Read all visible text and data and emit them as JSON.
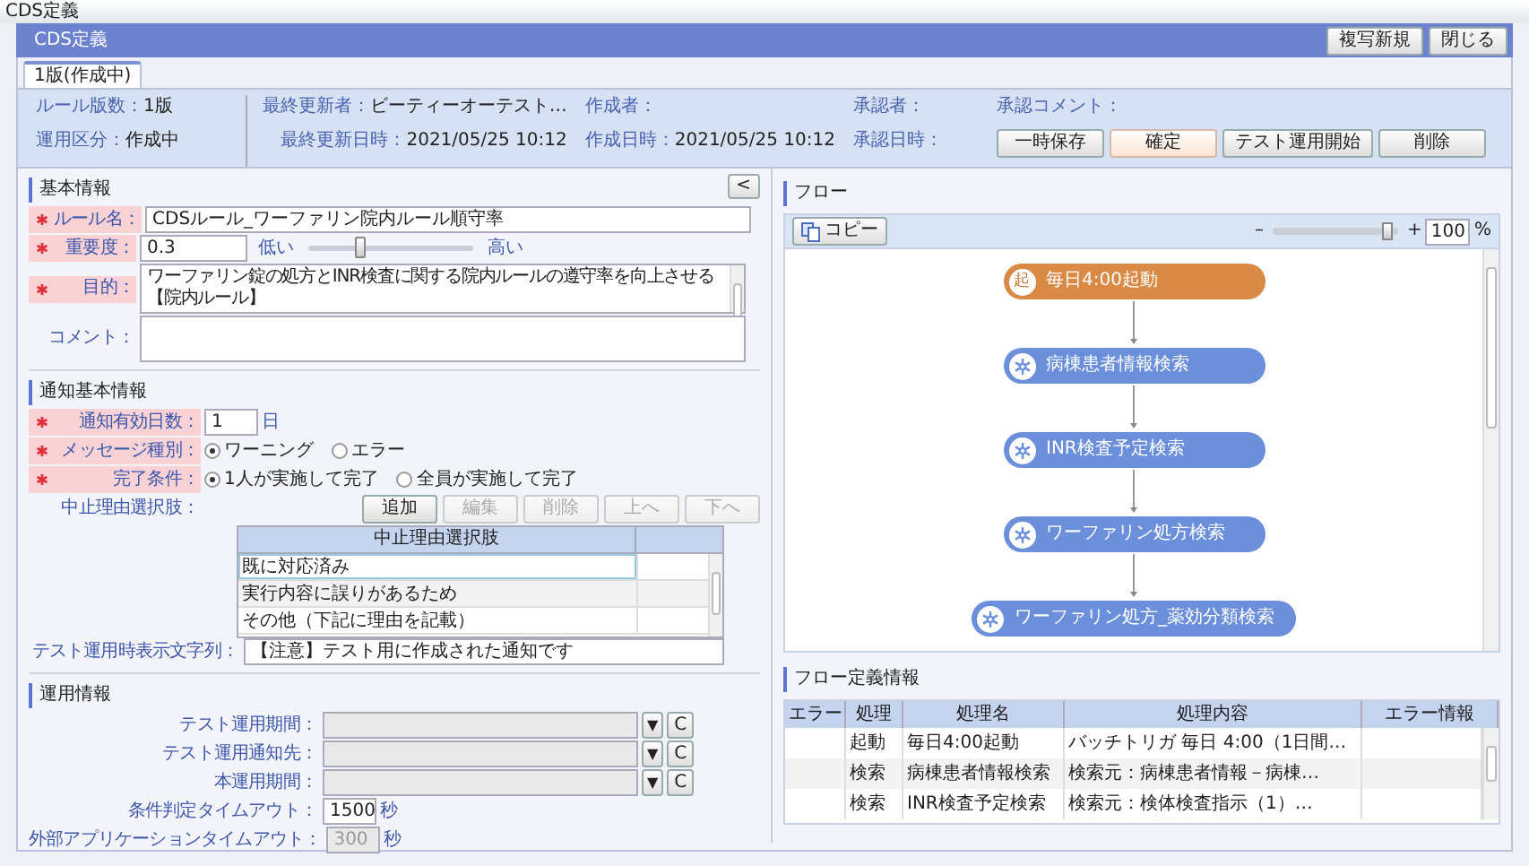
{
  "window": {
    "title": "CDS定義"
  },
  "header": {
    "title": "CDS定義",
    "buttons": [
      {
        "label": "複写新規"
      },
      {
        "label": "閉じる"
      }
    ]
  },
  "tabs": [
    {
      "label": "1版(作成中)",
      "selected": true
    }
  ],
  "summary": {
    "columns": [
      [
        {
          "label": "ルール版数：",
          "value": "1版"
        },
        {
          "label": "運用区分：",
          "value": "作成中"
        }
      ],
      [
        {
          "label": "最終更新者：",
          "value": "ビーティーオーテスト…"
        },
        {
          "label": "最終更新日時：",
          "value": "2021/05/25 10:12"
        }
      ],
      [
        {
          "label": "作成者："
        },
        {
          "label": "作成日時：",
          "value": "2021/05/25 10:12"
        }
      ],
      [
        {
          "label": "承認者："
        },
        {
          "label": "承認日時："
        }
      ],
      [
        {
          "label": "承認コメント："
        }
      ]
    ],
    "actions": [
      {
        "label": "一時保存",
        "highlighted": false
      },
      {
        "label": "確定",
        "highlighted": true
      },
      {
        "label": "テスト運用開始",
        "highlighted": false
      },
      {
        "label": "削除",
        "highlighted": false
      }
    ]
  },
  "basic_info": {
    "title": "基本情報",
    "collapse_button": "<",
    "fields": [
      {
        "kind": "text",
        "label": "ルール名：",
        "required": true,
        "value": "CDSルール_ワーファリン院内ルール順守率"
      },
      {
        "kind": "slider",
        "label": "重要度：",
        "required": true,
        "value": "0.3",
        "low": "低い",
        "high": "高い",
        "level": 0.3
      },
      {
        "kind": "textarea",
        "label": "目的：",
        "required": true,
        "lines": [
          "ワーファリン錠の処方とINR検査に関する院内ルールの遵守率を向上させる",
          "【院内ルール】"
        ]
      },
      {
        "kind": "textarea",
        "label": "コメント：",
        "required": false
      }
    ]
  },
  "notification": {
    "title": "通知基本情報",
    "fields": [
      {
        "kind": "number",
        "label": "通知有効日数：",
        "required": true,
        "value": "1",
        "unit": "日"
      },
      {
        "kind": "radio",
        "label": "メッセージ種別：",
        "required": true,
        "options": [
          {
            "label": "ワーニング",
            "selected": true
          },
          {
            "label": "エラー",
            "selected": false
          }
        ]
      },
      {
        "kind": "radio",
        "label": "完了条件：",
        "required": true,
        "options": [
          {
            "label": "1人が実施して完了",
            "selected": true
          },
          {
            "label": "全員が実施して完了",
            "selected": false
          }
        ]
      },
      {
        "kind": "list",
        "label": "中止理由選択肢：",
        "required": false,
        "buttons": [
          {
            "label": "追加",
            "disabled": false
          },
          {
            "label": "編集",
            "disabled": true
          },
          {
            "label": "削除",
            "disabled": true
          },
          {
            "label": "上へ",
            "disabled": true
          },
          {
            "label": "下へ",
            "disabled": true
          }
        ],
        "column": "中止理由選択肢",
        "rows": [
          {
            "text": "既に対応済み",
            "selected": true
          },
          {
            "text": "実行内容に誤りがあるため",
            "selected": false
          },
          {
            "text": "その他（下記に理由を記載）",
            "selected": false
          }
        ]
      },
      {
        "kind": "text",
        "label": "テスト運用時表示文字列：",
        "required": false,
        "value": "【注意】テスト用に作成された通知です"
      }
    ]
  },
  "operation": {
    "title": "運用情報",
    "fields": [
      {
        "kind": "select",
        "label": "テスト運用期間：",
        "disabled": true,
        "dropdown_button": "▼",
        "clear_button": "C"
      },
      {
        "kind": "select",
        "label": "テスト運用通知先：",
        "disabled": true,
        "dropdown_button": "▼",
        "clear_button": "C"
      },
      {
        "kind": "select",
        "label": "本運用期間：",
        "disabled": true,
        "dropdown_button": "▼",
        "clear_button": "C"
      },
      {
        "kind": "number",
        "label": "条件判定タイムアウト：",
        "value": "1500",
        "unit": "秒",
        "disabled": false
      },
      {
        "kind": "number",
        "label": "外部アプリケーションタイムアウト：",
        "value": "300",
        "unit": "秒",
        "disabled": true
      }
    ]
  },
  "flow": {
    "title": "フロー",
    "copy_button": "コピー",
    "zoom": {
      "minus": "–",
      "plus": "+",
      "value": "100",
      "unit": "%",
      "level": 0.95
    },
    "nodes": [
      {
        "kind": "trigger",
        "icon_text": "起",
        "label": "毎日4:00起動"
      },
      {
        "kind": "search",
        "label": "病棟患者情報検索"
      },
      {
        "kind": "search",
        "label": "INR検査予定検索"
      },
      {
        "kind": "search",
        "label": "ワーファリン処方検索"
      },
      {
        "kind": "search",
        "label": "ワーファリン処方_薬効分類検索"
      }
    ]
  },
  "flow_definition": {
    "title": "フロー定義情報",
    "columns": [
      "エラー",
      "処理",
      "処理名",
      "処理内容",
      "エラー情報"
    ],
    "rows": [
      {
        "process": "起動",
        "name": "毎日4:00起動",
        "content": "バッチトリガ 毎日 4:00（1日間…"
      },
      {
        "process": "検索",
        "name": "病棟患者情報検索",
        "content": "検索元：病棟患者情報－病棟…"
      },
      {
        "process": "検索",
        "name": "INR検査予定検索",
        "content": "検索元：検体検査指示（1）…"
      }
    ]
  }
}
